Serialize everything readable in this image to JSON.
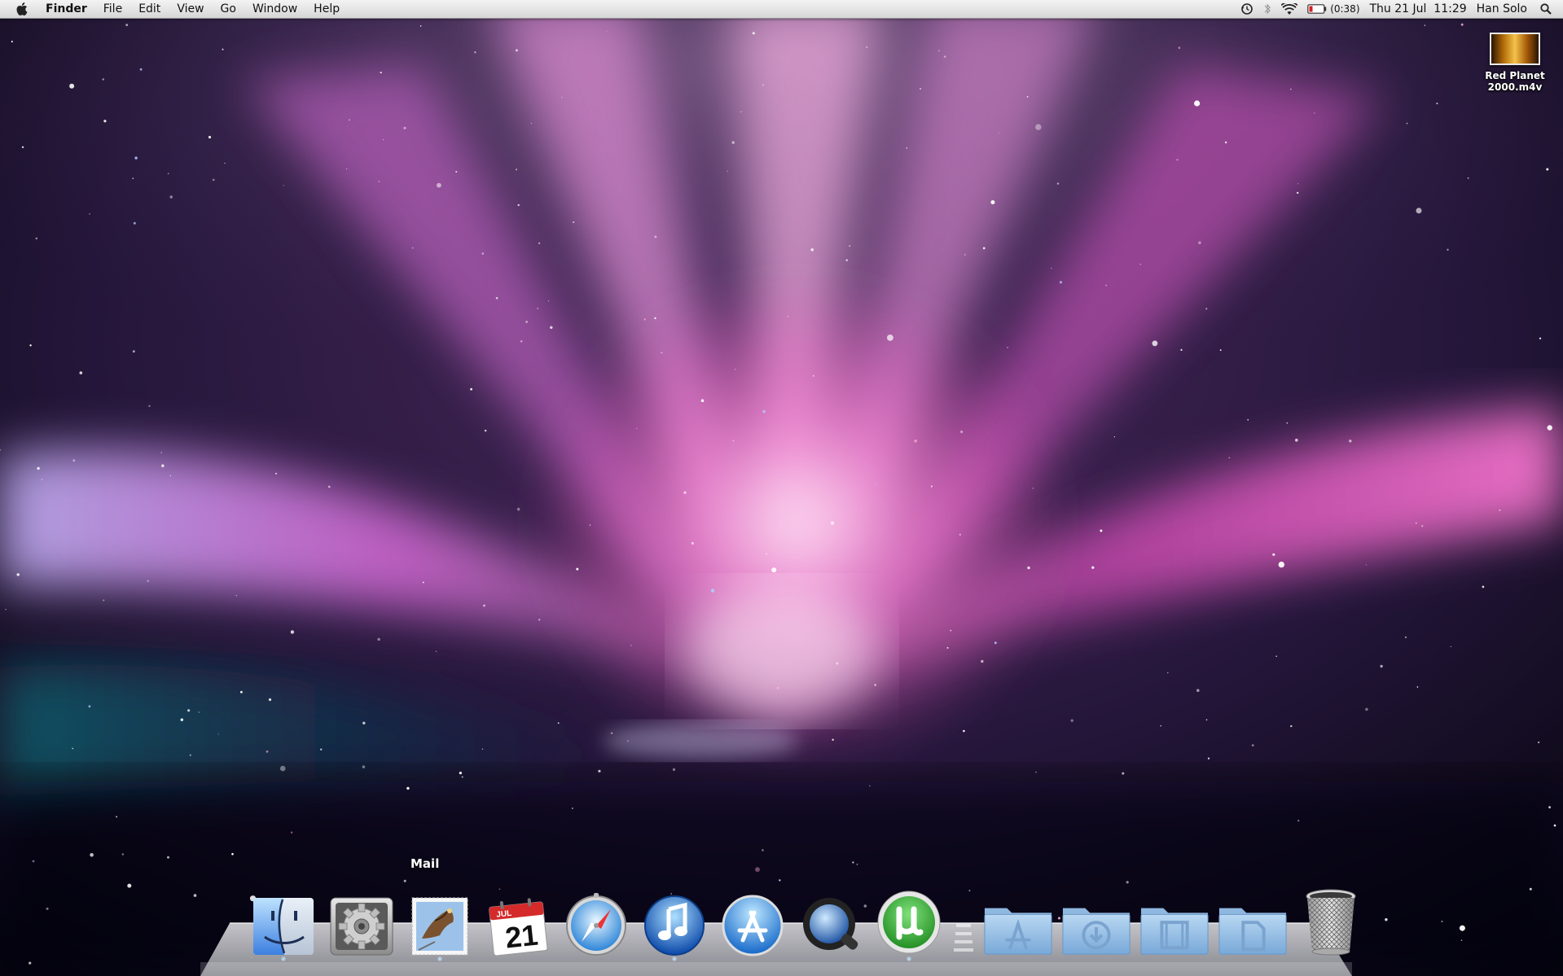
{
  "menubar": {
    "app_name": "Finder",
    "menus": [
      "File",
      "Edit",
      "View",
      "Go",
      "Window",
      "Help"
    ],
    "battery_time": "(0:38)",
    "datetime": "Thu 21 Jul  11:29",
    "user": "Han Solo",
    "icons": [
      "apple-logo-icon",
      "time-machine-icon",
      "bluetooth-icon",
      "wifi-icon",
      "battery-icon",
      "spotlight-icon"
    ]
  },
  "desktop": {
    "file_icon": {
      "name_line1": "Red Planet",
      "name_line2": "2000.m4v",
      "icon": "movie-thumbnail-icon"
    }
  },
  "dock": {
    "tooltip": "Mail",
    "calendar_month": "JUL",
    "calendar_day": "21",
    "apps": [
      {
        "id": "finder",
        "icon": "finder-icon"
      },
      {
        "id": "system-preferences",
        "icon": "gear-icon"
      },
      {
        "id": "mail",
        "icon": "mail-stamp-icon"
      },
      {
        "id": "ical",
        "icon": "calendar-icon"
      },
      {
        "id": "safari",
        "icon": "compass-icon"
      },
      {
        "id": "itunes",
        "icon": "music-note-icon"
      },
      {
        "id": "app-store",
        "icon": "app-store-icon"
      },
      {
        "id": "quicktime",
        "icon": "quicktime-icon"
      },
      {
        "id": "utorrent",
        "icon": "mu-icon"
      }
    ],
    "stacks": [
      {
        "id": "applications",
        "icon": "applications-folder-icon"
      },
      {
        "id": "downloads",
        "icon": "downloads-folder-icon"
      },
      {
        "id": "movies",
        "icon": "movies-folder-icon"
      },
      {
        "id": "documents",
        "icon": "documents-folder-icon"
      }
    ],
    "trash_icon": "trash-icon"
  },
  "colors": {
    "menubar_top": "#f4f4f4",
    "menubar_bottom": "#d6d6d6",
    "wallpaper_pink": "#ff6fcf",
    "wallpaper_purple": "#7a3da8",
    "wallpaper_space": "#05040c",
    "battery_red": "#d22020",
    "utorrent_green": "#2fa52c"
  }
}
